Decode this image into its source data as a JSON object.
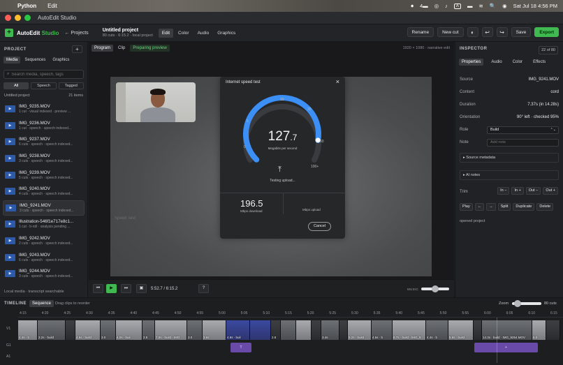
{
  "menubar": {
    "app": "Python",
    "menu": "Edit",
    "right_items": [
      "⏺",
      "4▬",
      "◎",
      "♪",
      "A",
      "▬",
      "≋",
      "🔍",
      "◉"
    ],
    "datetime": "Sat Jul 18  4:56 PM"
  },
  "window": {
    "title": "AutoEdit Studio"
  },
  "toolbar": {
    "brand_prefix": "AutoEdit",
    "brand_accent": "Studio",
    "back_label": "← Projects",
    "project_title": "Untitled project",
    "project_sub": "80 cuts · 6:15.2 · local project",
    "modes": [
      "Edit",
      "Color",
      "Audio",
      "Graphics"
    ],
    "active_mode": "Edit",
    "rename_label": "Rename",
    "newcut_label": "New cut",
    "save_label": "Save",
    "export_label": "Export",
    "accent_color": "#3fb950"
  },
  "sidebar": {
    "heading": "PROJECT",
    "add_label": "+",
    "tabs": [
      "Media",
      "Sequences",
      "Graphics"
    ],
    "search_placeholder": "Search media, speech, tags",
    "filters": [
      "All",
      "Speech",
      "Tagged"
    ],
    "project_name": "Untitled project",
    "item_count": "21 items",
    "clips": [
      {
        "name": "IMG_9235.MOV",
        "meta": "1 cut · visual indexed · preview ..."
      },
      {
        "name": "IMG_9236.MOV",
        "meta": "1 cut · speech · speech indexed..."
      },
      {
        "name": "IMG_9237.MOV",
        "meta": "6 cuts · speech · speech indexed..."
      },
      {
        "name": "IMG_9238.MOV",
        "meta": "3 cuts · speech · speech indexed..."
      },
      {
        "name": "IMG_9239.MOV",
        "meta": "5 cuts · speech · speech indexed..."
      },
      {
        "name": "IMG_9240.MOV",
        "meta": "4 cuts · speech · speech indexed..."
      },
      {
        "name": "IMG_9241.MOV",
        "meta": "3 cuts · speech · speech indexed..."
      },
      {
        "name": "Illustration-546f1e717e8c1...",
        "meta": "1 cut · b-roll · analysis pending ..."
      },
      {
        "name": "IMG_9242.MOV",
        "meta": "2 cuts · speech · speech indexed..."
      },
      {
        "name": "IMG_9243.MOV",
        "meta": "6 cuts · speech · speech indexed..."
      },
      {
        "name": "IMG_9244.MOV",
        "meta": "3 cuts · speech · speech indexed..."
      }
    ],
    "selected_index": 6,
    "footer": "Local media · transcript searchable"
  },
  "viewer": {
    "tabs": [
      "Program",
      "Clip",
      "Preparing preview"
    ],
    "info": "1920 × 1080 · narrative edit",
    "frame": {
      "dialog_title": "Internet speed test",
      "gauge_ticks": [
        "0",
        "5",
        "10",
        "20",
        "50",
        "100+"
      ],
      "gauge_level": 0.87,
      "speed_int": "127",
      "speed_dec": ".7",
      "speed_unit": "Megabits per second",
      "testing": "Testing upload...",
      "download_value": "196.5",
      "download_label": "Mbps download",
      "upload_label": "Mbps upload",
      "cancel": "Cancel",
      "bg_text": "Speed Test"
    },
    "timecode": "5:52.7 / 6:15.2",
    "help": "?",
    "music_label": "MUSIC",
    "music_level": 0.5
  },
  "inspector": {
    "heading": "INSPECTOR",
    "count": "22 of 80",
    "tabs": [
      "Properties",
      "Audio",
      "Color",
      "Effects"
    ],
    "source_k": "Source",
    "source_v": "IMG_9241.MOV",
    "content_k": "Content",
    "content_v": "cord",
    "duration_k": "Duration",
    "duration_v": "7.37s (in 14.28s)",
    "orientation_k": "Orientation",
    "orientation_v": "90° left · checked 95%",
    "role_k": "Role",
    "role_v": "Build",
    "note_k": "Note",
    "note_placeholder": "Add note",
    "source_meta": "▸ Source metadata",
    "ai_notes": "▸ AI notes",
    "trim_label": "Trim",
    "trim_buttons": [
      "In −",
      "In +",
      "Out −",
      "Out +"
    ],
    "actions": [
      "Play",
      "←",
      "→",
      "Split",
      "Duplicate",
      "Delete"
    ],
    "status": "opened project"
  },
  "timeline": {
    "heading": "TIMELINE",
    "sequence_tab": "Sequence",
    "hint": "Drag clips to reorder",
    "zoom_label": "Zoom",
    "zoom_level": 0.2,
    "cuts": "80 cuts",
    "ticks": [
      "4:15",
      "4:20",
      "4:25",
      "4:30",
      "4:35",
      "4:40",
      "4:45",
      "4:50",
      "4:55",
      "5:00",
      "5:05",
      "5:10",
      "5:15",
      "5:20",
      "5:25",
      "5:30",
      "5:35",
      "5:40",
      "5:45",
      "5:50",
      "5:55",
      "6:00",
      "6:05",
      "6:10",
      "6:15"
    ],
    "tracks": [
      "V1",
      "G1",
      "A1"
    ],
    "clips": [
      {
        "label": "4.4s · b",
        "tone": "light"
      },
      {
        "label": "3.2s · build",
        "tone": ""
      },
      {
        "label": "",
        "tone": "dark"
      },
      {
        "label": "4.5s · build",
        "tone": "light"
      },
      {
        "label": "3.0",
        "tone": ""
      },
      {
        "label": "4.0s · buil",
        "tone": "light"
      },
      {
        "label": "2.8",
        "tone": ""
      },
      {
        "label": "7.8s · build · IMG",
        "tone": "light"
      },
      {
        "label": "3.0",
        "tone": ""
      },
      {
        "label": "3.6s",
        "tone": "light"
      },
      {
        "label": "4.8s · buil",
        "tone": "blue"
      },
      {
        "label": "",
        "tone": "blue"
      },
      {
        "label": "2.8",
        "tone": "dark"
      },
      {
        "label": "",
        "tone": ""
      },
      {
        "label": "",
        "tone": "light"
      },
      {
        "label": "",
        "tone": "dark"
      },
      {
        "label": "3.4s",
        "tone": ""
      },
      {
        "label": "",
        "tone": "dark"
      },
      {
        "label": "5.2s · build",
        "tone": "light"
      },
      {
        "label": "4.5s · b",
        "tone": ""
      },
      {
        "label": "8.7s · build · IMG_9",
        "tone": "light"
      },
      {
        "label": "4.4s · b",
        "tone": ""
      },
      {
        "label": "5.8s · build",
        "tone": "light"
      },
      {
        "label": "",
        "tone": "dark"
      },
      {
        "label": "14.3s · build · IMG_9254.MOV",
        "tone": ""
      },
      {
        "label": "5.0",
        "tone": "light"
      },
      {
        "label": "",
        "tone": "dark"
      }
    ],
    "graphic_1": "T",
    "graphic_2": "+"
  }
}
